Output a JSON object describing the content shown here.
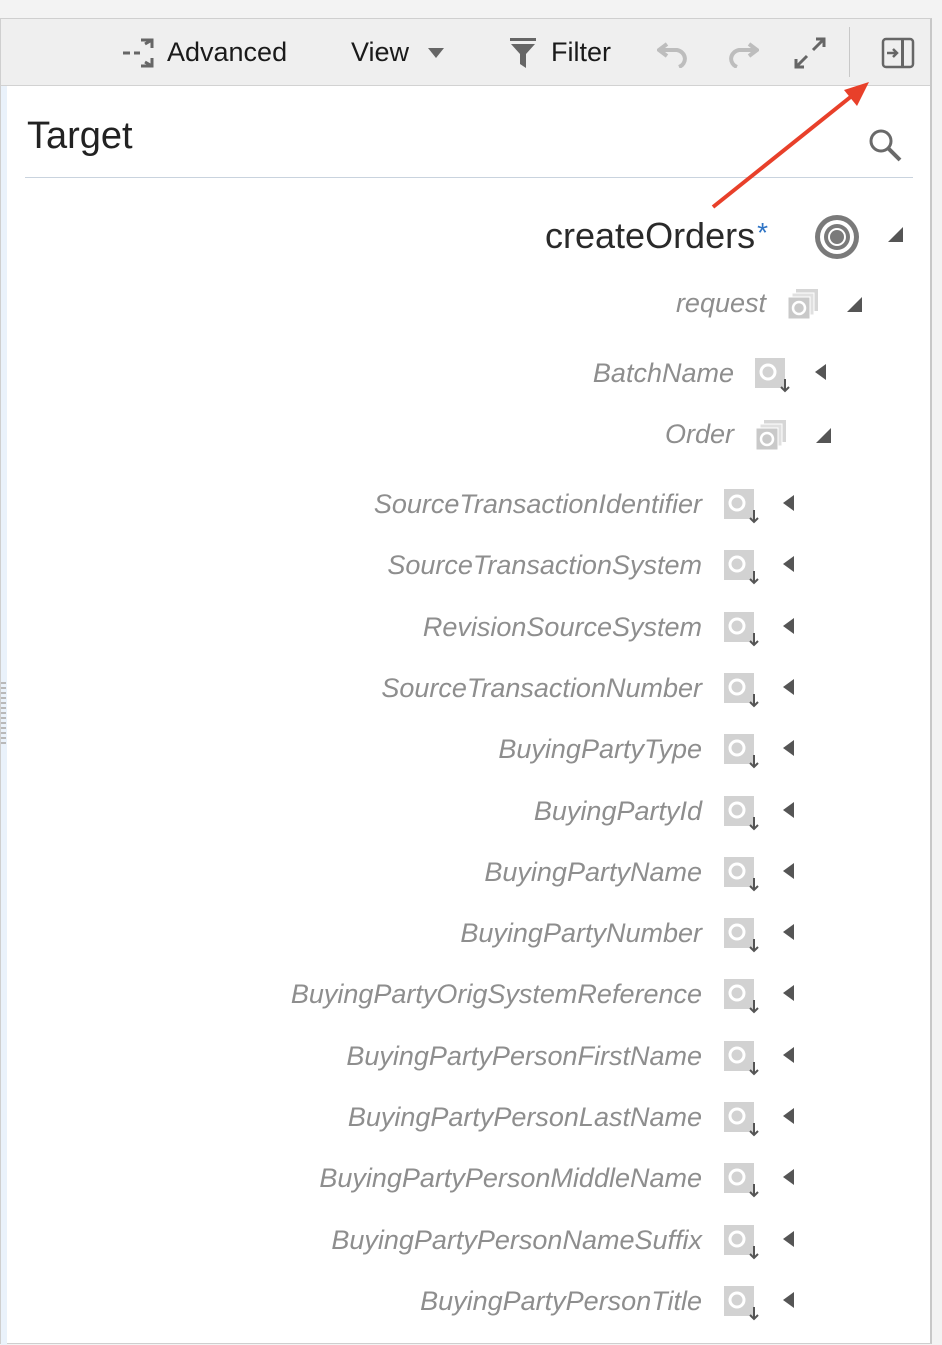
{
  "toolbar": {
    "advanced_label": "Advanced",
    "view_label": "View",
    "filter_label": "Filter"
  },
  "panel": {
    "title": "Target"
  },
  "tree": {
    "root": {
      "label": "createOrders",
      "required_marker": "*"
    },
    "request": "request",
    "batch_name": "BatchName",
    "order": "Order",
    "order_fields": [
      "SourceTransactionIdentifier",
      "SourceTransactionSystem",
      "RevisionSourceSystem",
      "SourceTransactionNumber",
      "BuyingPartyType",
      "BuyingPartyId",
      "BuyingPartyName",
      "BuyingPartyNumber",
      "BuyingPartyOrigSystemReference",
      "BuyingPartyPersonFirstName",
      "BuyingPartyPersonLastName",
      "BuyingPartyPersonMiddleName",
      "BuyingPartyPersonNameSuffix",
      "BuyingPartyPersonTitle"
    ]
  },
  "colors": {
    "annotation_arrow": "#e8402a",
    "asterisk": "#2f74c5",
    "node_text": "#8e8e8e"
  },
  "icons": {
    "advanced": "advanced-arrows-icon",
    "view_dropdown": "chevron-down-icon",
    "filter": "funnel-icon",
    "undo": "undo-icon",
    "redo": "redo-icon",
    "expand": "expand-icon",
    "collapse_panel": "collapse-panel-icon",
    "search": "magnifier-icon",
    "root": "target-icon",
    "container": "stacked-element-icon",
    "element": "leaf-element-icon"
  }
}
